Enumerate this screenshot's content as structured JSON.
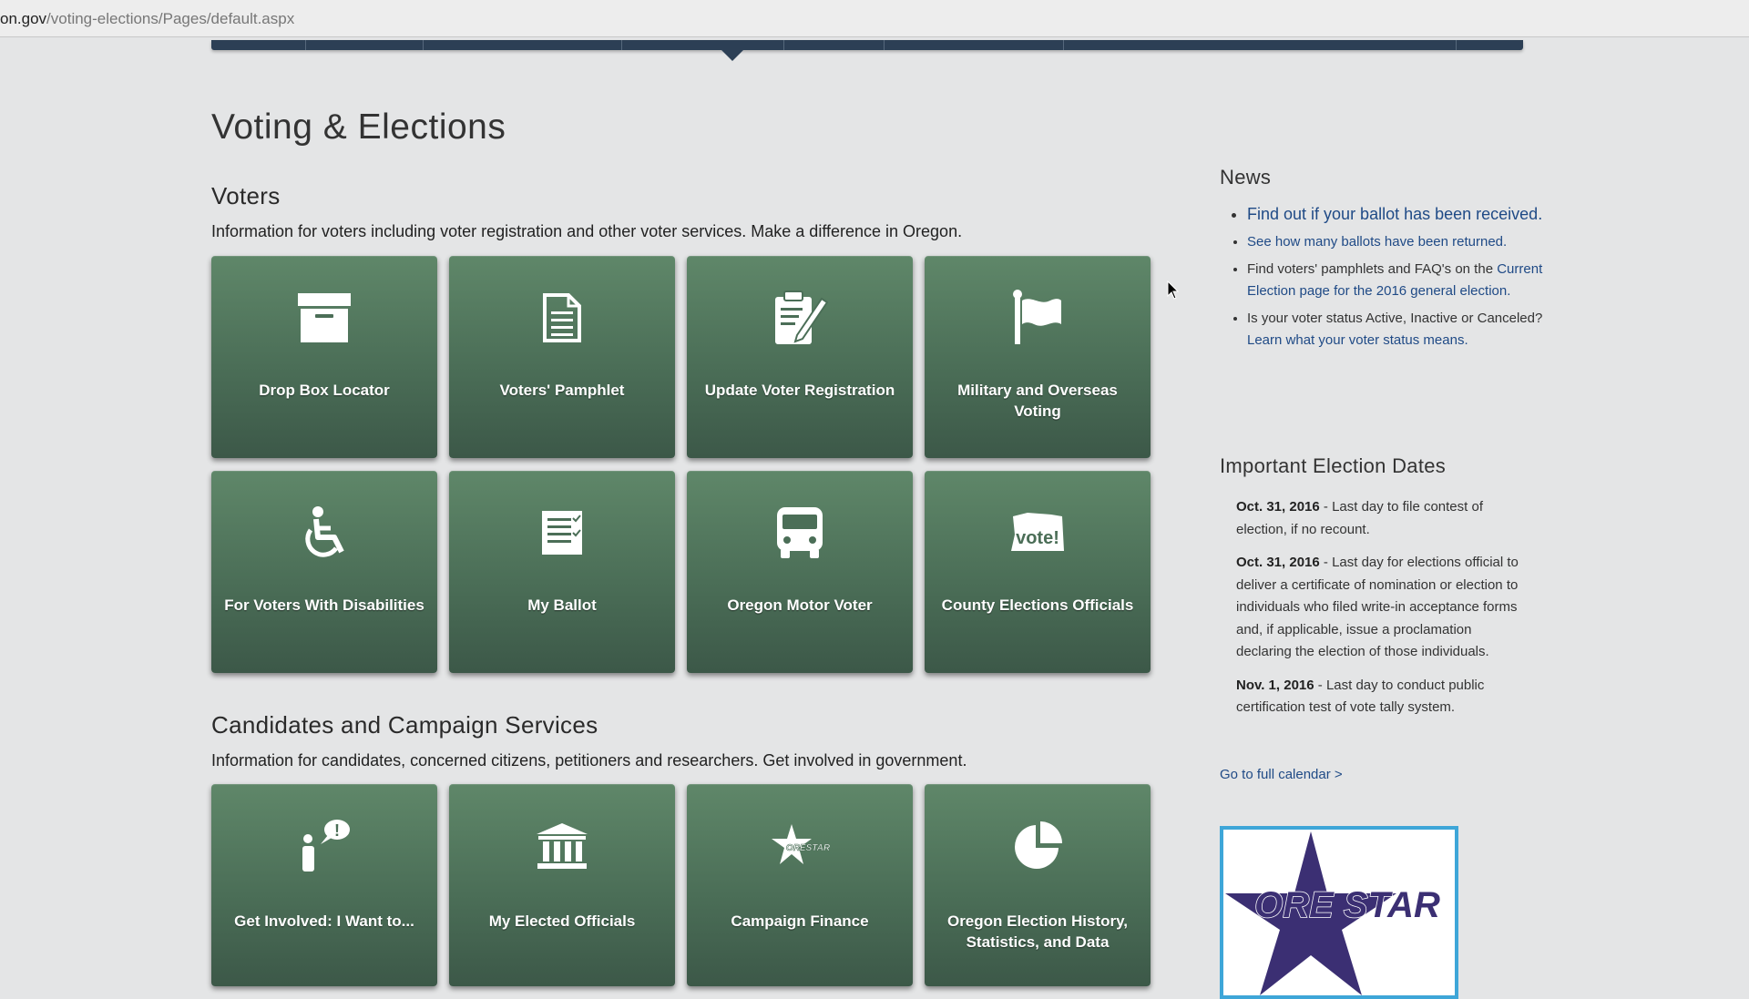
{
  "browser": {
    "url_domain": "on.gov",
    "url_path": "/voting-elections/Pages/default.aspx"
  },
  "page": {
    "title": "Voting & Elections"
  },
  "voters": {
    "title": "Voters",
    "description": "Information for voters including voter registration and other voter services. Make a difference in Oregon.",
    "tiles": [
      {
        "label": "Drop Box Locator",
        "icon": "drop-box-icon"
      },
      {
        "label": "Voters' Pamphlet",
        "icon": "document-icon"
      },
      {
        "label": "Update Voter Registration",
        "icon": "clipboard-pen-icon"
      },
      {
        "label": "Military and Overseas Voting",
        "icon": "flag-icon"
      },
      {
        "label": "For Voters With Disabilities",
        "icon": "wheelchair-icon"
      },
      {
        "label": "My Ballot",
        "icon": "ballot-icon"
      },
      {
        "label": "Oregon Motor Voter",
        "icon": "vehicle-icon"
      },
      {
        "label": "County Elections Officials",
        "icon": "oregon-vote-icon",
        "icon_text": "vote!"
      }
    ]
  },
  "candidates": {
    "title": "Candidates and Campaign Services",
    "description": "Information for candidates, concerned citizens, petitioners and researchers. Get involved in government.",
    "tiles": [
      {
        "label": "Get Involved: I Want to...",
        "icon": "person-speech-icon",
        "icon_text": "!"
      },
      {
        "label": "My Elected Officials",
        "icon": "capitol-building-icon"
      },
      {
        "label": "Campaign Finance",
        "icon": "orestar-star-icon",
        "icon_text": "ORESTAR"
      },
      {
        "label": "Oregon Election History, Statistics, and Data",
        "icon": "pie-chart-icon"
      }
    ]
  },
  "news": {
    "title": "News",
    "items": [
      {
        "text": "Find out if your ballot has been received."
      },
      {
        "text": "See how many ballots have been returned."
      },
      {
        "prefix": "Find voters' pamphlets and FAQ's on the ",
        "link": "Current Election page for the 2016 general election."
      },
      {
        "prefix": "Is your voter status Active, Inactive or Canceled? ",
        "link": "Learn what your voter status means."
      }
    ]
  },
  "dates": {
    "title": "Important Election Dates",
    "items": [
      {
        "date": "Oct. 31, 2016",
        "text": " - Last day to file contest of election, if no recount."
      },
      {
        "date": "Oct. 31, 2016",
        "text": " - Last day for elections official to deliver a certificate of nomination or election to individuals who filed write-in acceptance forms and, if applicable, issue a proclamation declaring the election of those individuals."
      },
      {
        "date": "Nov. 1, 2016",
        "text": " - Last day to conduct public certification test of vote tally system."
      }
    ],
    "calendar_link": "Go to full calendar >"
  },
  "orestar_banner": {
    "text": "ORE STAR"
  },
  "colors": {
    "tile_green": "#4b6e57",
    "nav_blue": "#2c3f55",
    "link_blue": "#1f4a86",
    "banner_border": "#3ea6d8",
    "star_purple": "#3b2f73"
  }
}
